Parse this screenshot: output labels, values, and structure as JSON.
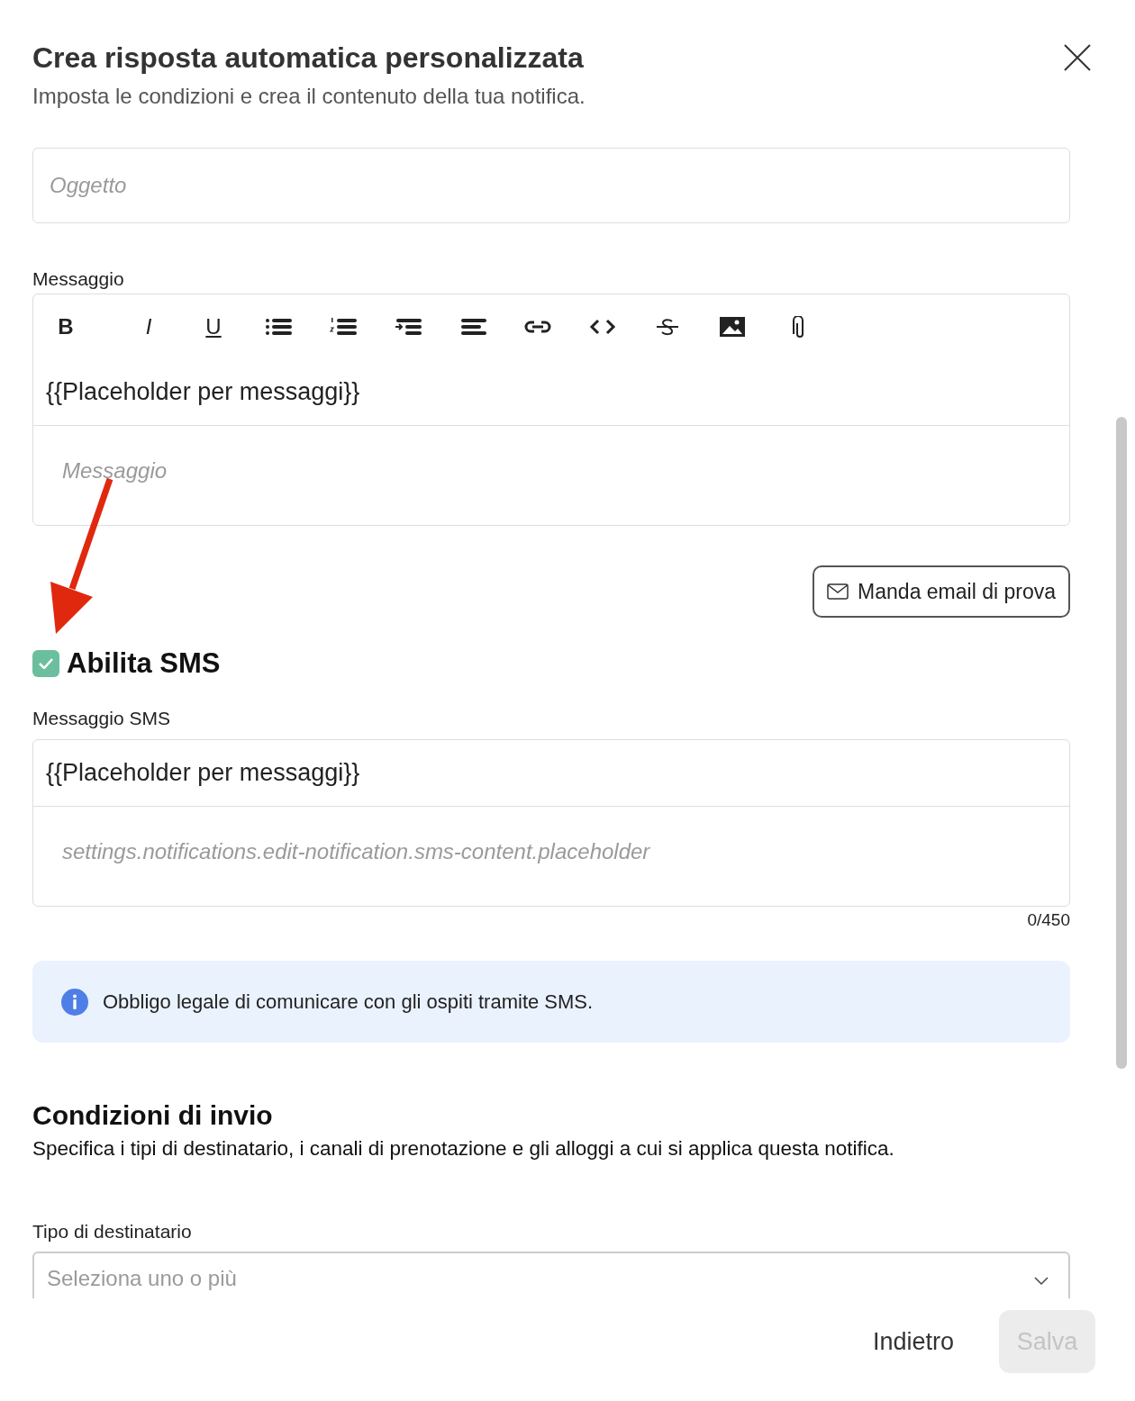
{
  "dialog": {
    "title": "Crea risposta automatica personalizzata",
    "subtitle": "Imposta le condizioni e crea il contenuto della tua notifica."
  },
  "subject_field": {
    "placeholder": "Oggetto"
  },
  "message": {
    "label": "Messaggio",
    "format_buttons": [
      "B",
      "I",
      "U"
    ],
    "token": "{{Placeholder per messaggi}}",
    "placeholder": "Messaggio"
  },
  "test_email_button": "Manda email di prova",
  "sms": {
    "enabled": true,
    "label": "Abilita SMS",
    "field_label": "Messaggio SMS",
    "token": "{{Placeholder per messaggi}}",
    "placeholder": "settings.notifications.edit-notification.sms-content.placeholder",
    "counter": "0/450"
  },
  "info": "Obbligo legale di comunicare con gli ospiti tramite SMS.",
  "conditions": {
    "title": "Condizioni di invio",
    "description": "Specifica i tipi di destinatario, i canali di prenotazione e gli alloggi a cui si applica questa notifica.",
    "recipient_label": "Tipo di destinatario",
    "recipient_placeholder": "Seleziona uno o più"
  },
  "footer": {
    "back": "Indietro",
    "save": {
      "label": "Salva",
      "disabled": true
    }
  }
}
